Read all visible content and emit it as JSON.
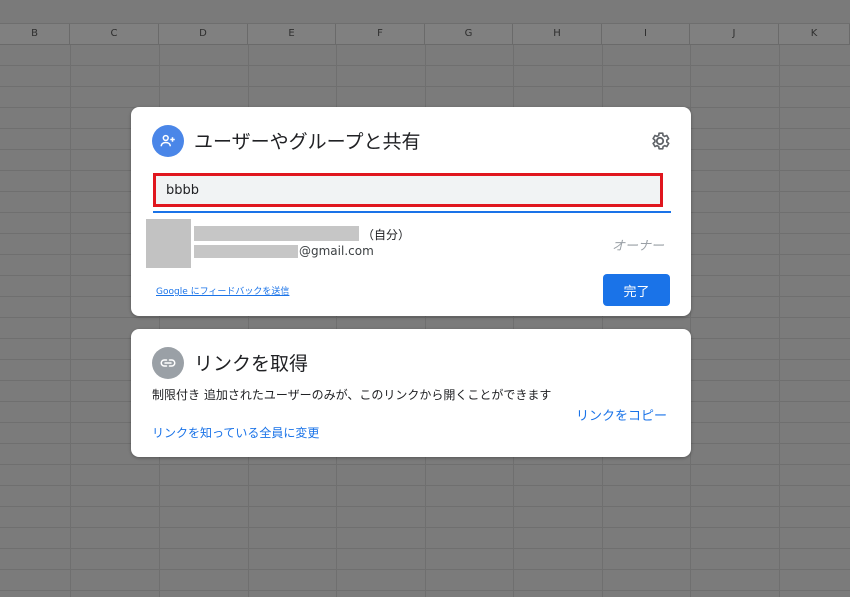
{
  "sheet": {
    "columns": [
      "B",
      "C",
      "D",
      "E",
      "F",
      "G",
      "H",
      "I",
      "J",
      "K"
    ]
  },
  "share_dialog": {
    "title": "ユーザーやグループと共有",
    "search_value": "bbbb",
    "person": {
      "self_label": "（自分）",
      "email_suffix": "@gmail.com",
      "role": "オーナー"
    },
    "feedback_link": "Google にフィードバックを送信",
    "done_button": "完了"
  },
  "link_dialog": {
    "title": "リンクを取得",
    "description": "制限付き 追加されたユーザーのみが、このリンクから開くことができます",
    "change_link": "リンクを知っている全員に変更",
    "copy_link": "リンクをコピー"
  },
  "colors": {
    "accent": "#1a73e8",
    "highlight_border": "#e0161e",
    "add_person_icon_bg": "#4a86e8",
    "link_icon_bg": "#9aa0a6"
  },
  "icons": {
    "share": "add-person-icon",
    "link": "link-icon",
    "settings": "gear-icon"
  }
}
